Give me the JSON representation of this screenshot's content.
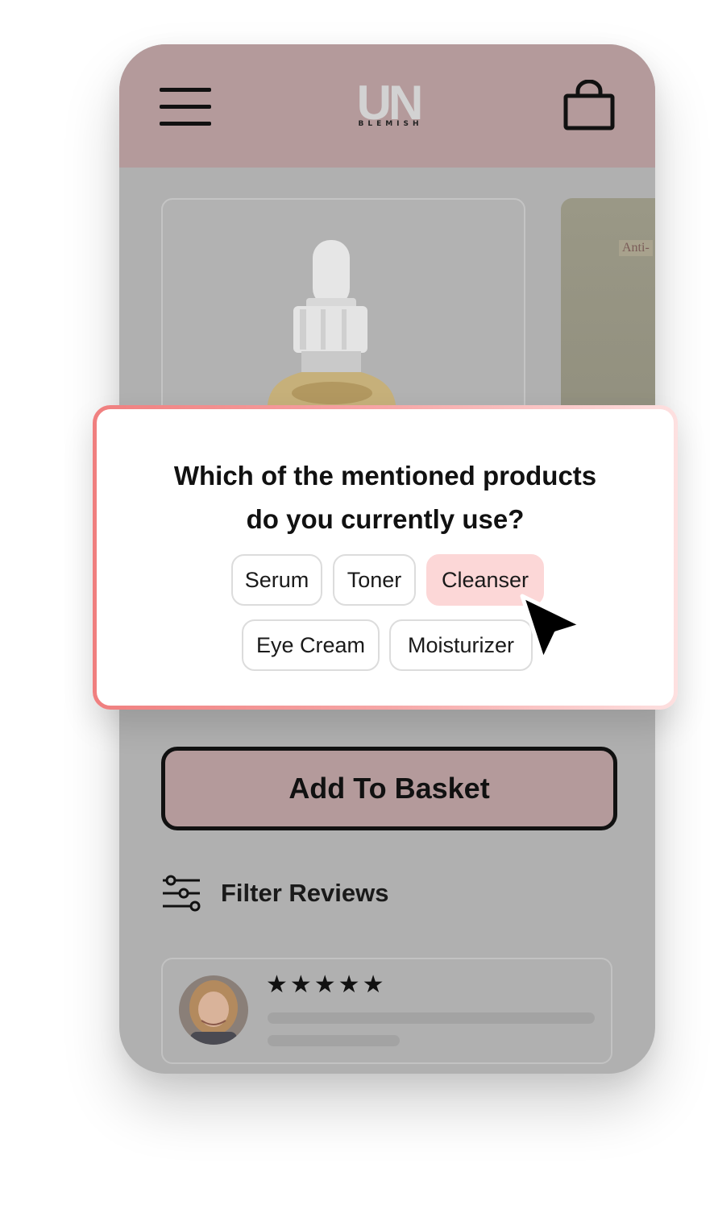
{
  "colors": {
    "header_bg": "#b49a9b",
    "page_overlay": "#b0b0b0",
    "selected_chip": "#fcd7d7",
    "survey_border_start": "#f07f7f",
    "survey_border_end": "#fde0e0"
  },
  "header": {
    "menu_icon": "hamburger-menu-icon",
    "logo_mark": "UN",
    "logo_sub": "BLEMISH",
    "bag_icon": "shopping-bag-icon"
  },
  "products": {
    "side_card_label": "Anti-"
  },
  "survey": {
    "question_line1": "Which of the mentioned products",
    "question_line2": "do you currently use?",
    "options": [
      {
        "label": "Serum",
        "selected": false
      },
      {
        "label": "Toner",
        "selected": false
      },
      {
        "label": "Cleanser",
        "selected": true
      },
      {
        "label": "Eye Cream",
        "selected": false
      },
      {
        "label": "Moisturizer",
        "selected": false
      }
    ]
  },
  "actions": {
    "add_to_basket": "Add To Basket",
    "filter_reviews": "Filter Reviews",
    "filter_icon": "sliders-filter-icon"
  },
  "review": {
    "stars": "★★★★★",
    "rating": 5,
    "avatar": "reviewer-avatar"
  }
}
